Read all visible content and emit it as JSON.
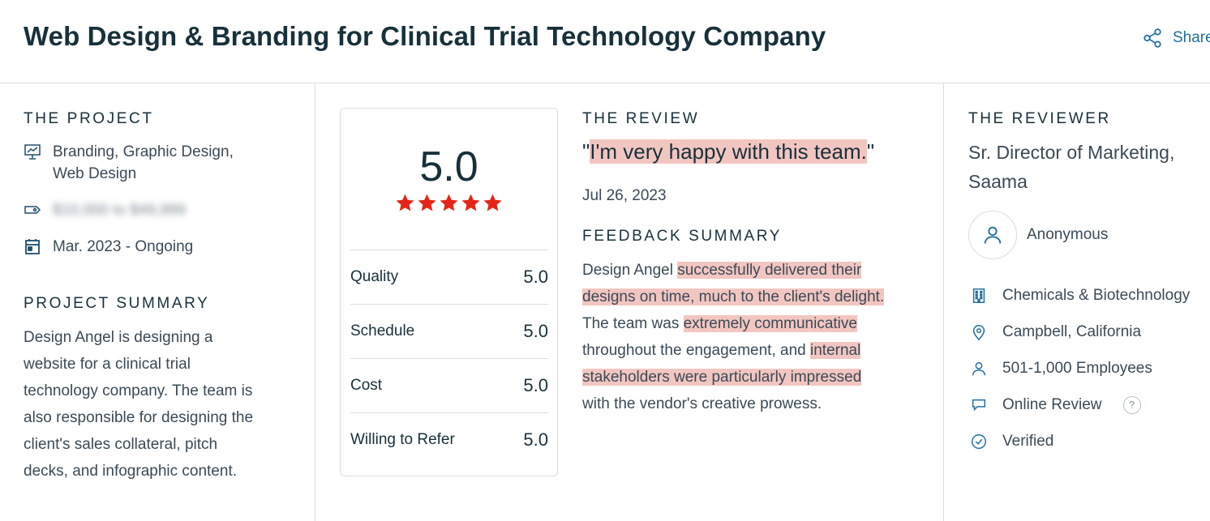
{
  "header": {
    "title": "Web Design & Branding for Clinical Trial Technology Company",
    "share_label": "Share"
  },
  "project": {
    "section_label": "THE PROJECT",
    "services_line1": "Branding, Graphic Design,",
    "services_line2": "Web Design",
    "budget": "$10,000 to $49,999",
    "timeline": "Mar. 2023 - Ongoing",
    "summary_label": "PROJECT SUMMARY",
    "summary_lines": [
      "Design Angel is designing a",
      "website for a clinical trial",
      "technology company. The team is",
      "also responsible for designing the",
      "client's sales collateral, pitch",
      "decks, and infographic content."
    ]
  },
  "rating": {
    "overall": "5.0",
    "stars": 5,
    "rows": [
      {
        "label": "Quality",
        "value": "5.0"
      },
      {
        "label": "Schedule",
        "value": "5.0"
      },
      {
        "label": "Cost",
        "value": "5.0"
      },
      {
        "label": "Willing to Refer",
        "value": "5.0"
      }
    ],
    "star_color": "#e62415"
  },
  "review": {
    "section_label": "THE REVIEW",
    "quote_open": "\"",
    "quote_text": "I'm very happy with this team.",
    "quote_close": "\"",
    "date": "Jul 26, 2023",
    "feedback_label": "FEEDBACK SUMMARY",
    "feedback": {
      "l1_plain": "Design Angel ",
      "l1_hl": "successfully delivered their",
      "l2_hl": "designs on time, much to the client's delight.",
      "l3_plain": "The team was ",
      "l3_hl": "extremely communicative",
      "l4_plain": "throughout the engagement, and ",
      "l4_hl": "internal",
      "l5_hl": "stakeholders were particularly impressed",
      "l6_plain": "with the vendor's creative prowess."
    },
    "highlight_color": "#f2c6c0"
  },
  "reviewer": {
    "section_label": "THE REVIEWER",
    "title_line1": "Sr. Director of Marketing,",
    "title_line2": "Saama",
    "name": "Anonymous",
    "industry": "Chemicals & Biotechnology",
    "location": "Campbell, California",
    "size": "501-1,000 Employees",
    "review_type": "Online Review",
    "help_glyph": "?",
    "status": "Verified"
  },
  "colors": {
    "heading": "#17313b",
    "text": "#3a4a56",
    "accent": "#1f6f9e",
    "border": "#d8dee2"
  }
}
